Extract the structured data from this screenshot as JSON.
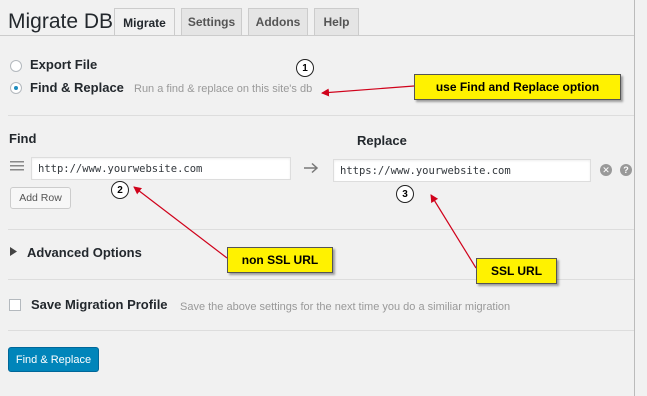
{
  "header": {
    "title": "Migrate DB",
    "tabs": [
      {
        "label": "Migrate",
        "active": true
      },
      {
        "label": "Settings",
        "active": false
      },
      {
        "label": "Addons",
        "active": false
      },
      {
        "label": "Help",
        "active": false
      }
    ]
  },
  "options": {
    "export_label": "Export File",
    "find_replace_label": "Find & Replace",
    "find_replace_hint": "Run a find & replace on this site's db"
  },
  "find_replace": {
    "find_heading": "Find",
    "replace_heading": "Replace",
    "find_value": "http://www.yourwebsite.com",
    "replace_value": "https://www.yourwebsite.com",
    "add_row_label": "Add Row",
    "remove_icon_glyph": "✕",
    "help_icon_glyph": "?"
  },
  "advanced": {
    "label": "Advanced Options"
  },
  "profile": {
    "label": "Save Migration Profile",
    "hint": "Save the above settings for the next time you do a similiar migration"
  },
  "submit": {
    "label": "Find & Replace"
  },
  "annotations": {
    "callout_1": "use Find and Replace option",
    "callout_2": "non SSL URL",
    "callout_3": "SSL URL",
    "badge_1": "1",
    "badge_2": "2",
    "badge_3": "3"
  },
  "colors": {
    "accent": "#0085ba",
    "callout_bg": "#fff200",
    "arrow": "#d0021b"
  }
}
